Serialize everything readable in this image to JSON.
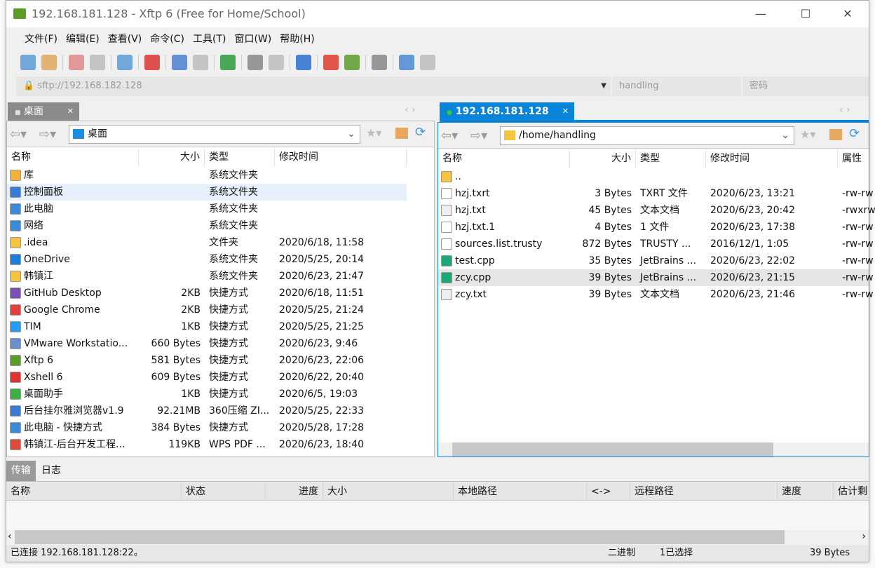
{
  "window": {
    "title": "192.168.181.128 - Xftp 6 (Free for Home/School)"
  },
  "menu": [
    "文件(F)",
    "编辑(E)",
    "查看(V)",
    "命令(C)",
    "工具(T)",
    "窗口(W)",
    "帮助(H)"
  ],
  "toolbar": [
    "new-session-icon",
    "open-folder-icon",
    "disconnect-icon",
    "reconnect-icon",
    "properties-icon",
    "media-icon",
    "upload-icon",
    "download-icon",
    "sync-icon",
    "copy-icon",
    "paste-icon",
    "globe-icon",
    "xshell-icon",
    "xftp-icon",
    "settings-icon",
    "help-icon",
    "chat-icon"
  ],
  "address": {
    "host": "sftp://192.168.182.128",
    "user_placeholder": "handling",
    "password_placeholder": "密码"
  },
  "left": {
    "tab": "桌面",
    "path": "桌面",
    "headers": [
      "名称",
      "大小",
      "类型",
      "修改时间"
    ],
    "rows": [
      [
        "库",
        "",
        "系统文件夹",
        "",
        "#f2b33d"
      ],
      [
        "控制面板",
        "",
        "系统文件夹",
        "",
        "#3a7bd5"
      ],
      [
        "此电脑",
        "",
        "系统文件夹",
        "",
        "#3a8ad5"
      ],
      [
        "网络",
        "",
        "系统文件夹",
        "",
        "#3a8ad5"
      ],
      [
        ".idea",
        "",
        "文件夹",
        "2020/6/18, 11:58",
        "#f5c542"
      ],
      [
        "OneDrive",
        "",
        "系统文件夹",
        "2020/5/25, 20:14",
        "#1e7fd8"
      ],
      [
        "韩镇江",
        "",
        "系统文件夹",
        "2020/6/23, 21:47",
        "#f5c542"
      ],
      [
        "GitHub Desktop",
        "2KB",
        "快捷方式",
        "2020/6/18, 11:51",
        "#7b4fb3"
      ],
      [
        "Google Chrome",
        "2KB",
        "快捷方式",
        "2020/5/25, 21:24",
        "#e0413a"
      ],
      [
        "TIM",
        "1KB",
        "快捷方式",
        "2020/5/25, 21:25",
        "#2a9bf0"
      ],
      [
        "VMware Workstatio...",
        "660 Bytes",
        "快捷方式",
        "2020/6/23, 9:46",
        "#6a8fc9"
      ],
      [
        "Xftp 6",
        "581 Bytes",
        "快捷方式",
        "2020/6/23, 22:06",
        "#5a9b2a"
      ],
      [
        "Xshell 6",
        "609 Bytes",
        "快捷方式",
        "2020/6/22, 20:40",
        "#d33"
      ],
      [
        "桌面助手",
        "1KB",
        "快捷方式",
        "2020/6/5, 19:03",
        "#3cb043"
      ],
      [
        "后台挂尔雅浏览器v1.9",
        "92.21MB",
        "360压缩 ZI...",
        "2020/5/25, 22:33",
        "#3a7bd5"
      ],
      [
        "此电脑 - 快捷方式",
        "384 Bytes",
        "快捷方式",
        "2020/5/28, 17:28",
        "#3a8ad5"
      ],
      [
        "韩镇江-后台开发工程...",
        "119KB",
        "WPS PDF ...",
        "2020/6/23, 18:40",
        "#e04a3a"
      ]
    ],
    "selected": 1
  },
  "right": {
    "tab": "192.168.181.128",
    "path": "/home/handling",
    "headers": [
      "名称",
      "大小",
      "类型",
      "修改时间",
      "属性"
    ],
    "rows": [
      [
        "..",
        "",
        "",
        "",
        "",
        "#f5c542"
      ],
      [
        "hzj.txrt",
        "3 Bytes",
        "TXRT 文件",
        "2020/6/23, 13:21",
        "-rw-rw",
        "#fff"
      ],
      [
        "hzj.txt",
        "45 Bytes",
        "文本文档",
        "2020/6/23, 20:42",
        "-rwxrw",
        "#eee"
      ],
      [
        "hzj.txt.1",
        "4 Bytes",
        "1 文件",
        "2020/6/23, 17:38",
        "-rw-rw",
        "#fff"
      ],
      [
        "sources.list.trusty",
        "872 Bytes",
        "TRUSTY ...",
        "2016/12/1, 1:05",
        "-rw-rw",
        "#fff"
      ],
      [
        "test.cpp",
        "35 Bytes",
        "JetBrains ...",
        "2020/6/23, 22:02",
        "-rw-rw",
        "#1aa87a"
      ],
      [
        "zcy.cpp",
        "39 Bytes",
        "JetBrains ...",
        "2020/6/23, 21:15",
        "-rw-rw",
        "#1aa87a"
      ],
      [
        "zcy.txt",
        "39 Bytes",
        "文本文档",
        "2020/6/23, 21:46",
        "-rw-rw",
        "#eee"
      ]
    ],
    "selected": 6
  },
  "bottom": {
    "tabs": [
      "传输",
      "日志"
    ],
    "headers": [
      "名称",
      "状态",
      "进度",
      "大小",
      "本地路径",
      "<->",
      "远程路径",
      "速度",
      "估计剩"
    ]
  },
  "status": {
    "connection": "已连接 192.168.181.128:22。",
    "mode": "二进制",
    "selection": "1已选择",
    "size": "39 Bytes"
  },
  "colors": {
    "accent": "#0a84d8",
    "selected_row": "#e6e6e6",
    "left_selected": "#e5f0fb"
  }
}
